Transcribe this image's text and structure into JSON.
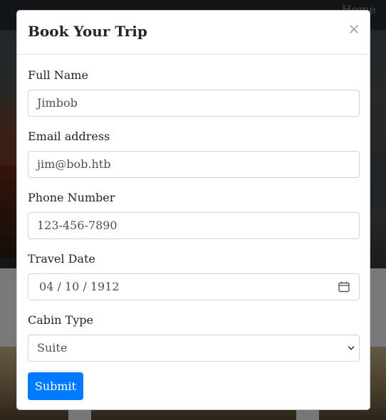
{
  "background": {
    "nav_link": "Home"
  },
  "modal": {
    "title": "Book Your Trip",
    "close_icon": "close-icon",
    "fields": {
      "full_name": {
        "label": "Full Name",
        "value": "Jimbob"
      },
      "email": {
        "label": "Email address",
        "value": "jim@bob.htb"
      },
      "phone": {
        "label": "Phone Number",
        "value": "123-456-7890"
      },
      "travel_date": {
        "label": "Travel Date",
        "value": "04 / 10 / 1912",
        "icon": "calendar-icon"
      },
      "cabin_type": {
        "label": "Cabin Type",
        "value": "Suite",
        "icon": "chevron-down-icon"
      }
    },
    "submit_label": "Submit"
  },
  "colors": {
    "primary": "#007bff",
    "navbar": "#222a2e",
    "input_border": "#ced4da"
  }
}
